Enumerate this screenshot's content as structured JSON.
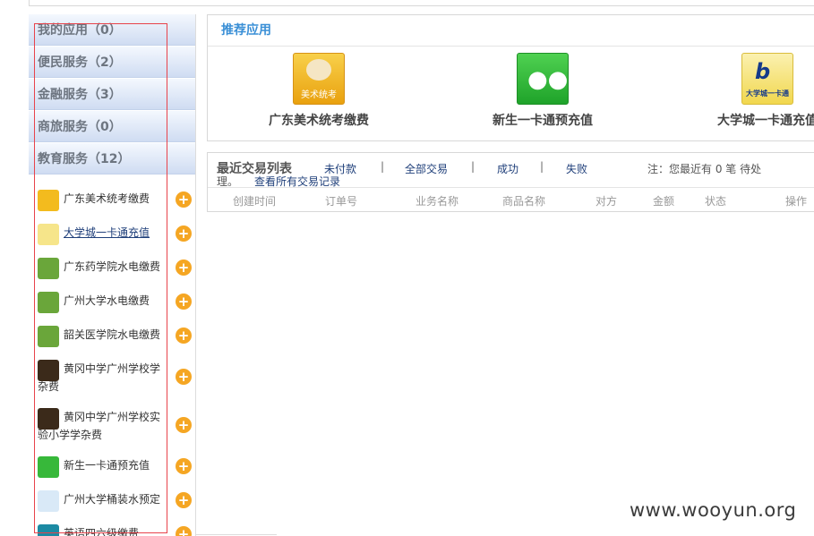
{
  "sidebar": {
    "categories": [
      {
        "label": "我的应用（0）"
      },
      {
        "label": "便民服务（2）"
      },
      {
        "label": "金融服务（3）"
      },
      {
        "label": "商旅服务（0）"
      },
      {
        "label": "教育服务（12）"
      }
    ],
    "apps": [
      {
        "label": "广东美术统考缴费",
        "icon": "art-palette-icon"
      },
      {
        "label": "大学城一卡通充值",
        "icon": "campus-card-icon"
      },
      {
        "label": "广东药学院水电缴费",
        "icon": "water-tap-icon"
      },
      {
        "label": "广州大学水电缴费",
        "icon": "water-tap-icon"
      },
      {
        "label": "韶关医学院水电缴费",
        "icon": "water-tap-icon"
      },
      {
        "label": "黄冈中学广州学校学杂费",
        "icon": "school-logo-icon"
      },
      {
        "label": "黄冈中学广州学校实验小学学杂费",
        "icon": "school-logo-icon"
      },
      {
        "label": "新生一卡通预充值",
        "icon": "people-icon"
      },
      {
        "label": "广州大学桶装水预定",
        "icon": "water-bottle-icon"
      },
      {
        "label": "英语四六级缴费",
        "icon": "english-exam-icon"
      }
    ],
    "add_symbol": "+"
  },
  "recommended": {
    "title": "推荐应用",
    "items": [
      {
        "label": "广东美术统考缴费",
        "icon_caption": "美术统考"
      },
      {
        "label": "新生一卡通预充值"
      },
      {
        "label": "大学城一卡通充值",
        "icon_caption": "大学城一卡通"
      }
    ]
  },
  "transactions": {
    "title": "最近交易列表",
    "title_tail": "理。",
    "filters": [
      "未付款",
      "全部交易",
      "成功",
      "失败"
    ],
    "separator": "|",
    "note": "注：您最近有 0 笔 待处",
    "view_all": "查看所有交易记录",
    "columns": [
      "创建时间",
      "订单号",
      "业务名称",
      "商品名称",
      "对方",
      "金额",
      "状态",
      "操作"
    ]
  },
  "watermark": "www.wooyun.org",
  "colors": {
    "accent": "#3a8fd6",
    "highlight_box": "#e8434b",
    "add_button": "#f5a623"
  }
}
